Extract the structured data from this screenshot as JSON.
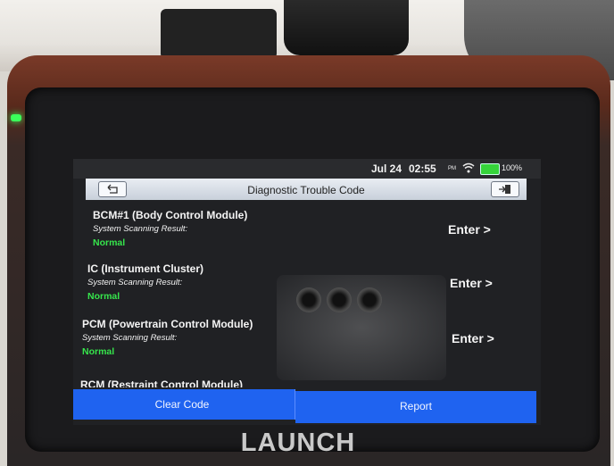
{
  "status_bar": {
    "date": "Jul 24",
    "time": "02:55",
    "ampm": "PM",
    "battery": "100%",
    "battery_color": "#35d43a"
  },
  "header": {
    "title": "Diagnostic Trouble Code",
    "back_icon": "back-arrow-icon",
    "exit_icon": "exit-icon"
  },
  "modules": [
    {
      "name": "BCM#1 (Body Control Module)",
      "scan_label": "System Scanning Result:",
      "status": "Normal",
      "action": "Enter >"
    },
    {
      "name": "IC (Instrument Cluster)",
      "scan_label": "System Scanning Result:",
      "status": "Normal",
      "action": "Enter >"
    },
    {
      "name": "PCM (Powertrain Control Module)",
      "scan_label": "System Scanning Result:",
      "status": "Normal",
      "action": "Enter >"
    }
  ],
  "partial_row": "RCM (Restraint Control Module)",
  "actions": {
    "clear": "Clear Code",
    "report": "Report",
    "accent": "#1f63f0"
  },
  "device": {
    "brand": "LAUNCH"
  },
  "colors": {
    "normal_status": "#36e54c",
    "led": "#3bff5a"
  }
}
